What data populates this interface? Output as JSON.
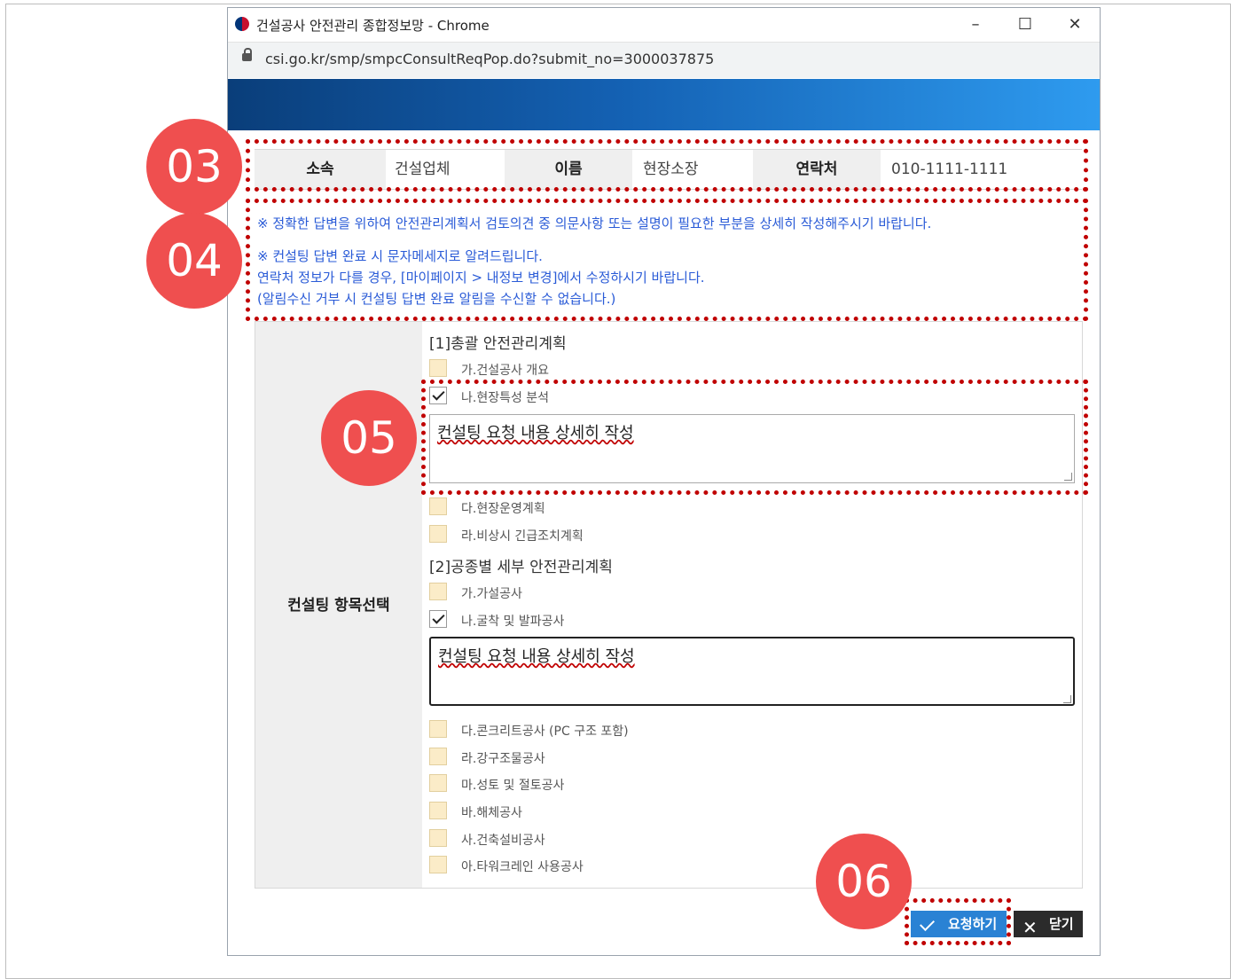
{
  "window": {
    "title": "건설공사 안전관리 종합정보망 - Chrome",
    "minimize": "–",
    "maximize": "☐",
    "close": "✕",
    "url": "csi.go.kr/smp/smpcConsultReqPop.do?submit_no=3000037875"
  },
  "info": {
    "affiliation_label": "소속",
    "affiliation_value": "건설업체",
    "name_label": "이름",
    "name_value": "현장소장",
    "contact_label": "연락처",
    "contact_value": "010-1111-1111"
  },
  "notices": {
    "line1": "※ 정확한 답변을 위하여 안전관리계획서 검토의견 중 의문사항 또는 설명이 필요한 부분을 상세히 작성해주시기 바랍니다.",
    "line2": "※ 컨설팅 답변 완료 시 문자메세지로 알려드립니다.",
    "line3": "연락처 정보가 다를 경우, [마이페이지 > 내정보 변경]에서 수정하시기 바랍니다.",
    "line4": "(알림수신 거부 시 컨설팅 답변 완료 알림을 수신할 수 없습니다.)"
  },
  "form": {
    "label": "컨설팅 항목선택",
    "section1": "[1]총괄 안전관리계획",
    "section2": "[2]공종별 세부 안전관리계획",
    "items1": [
      {
        "label": "가.건설공사 개요",
        "checked": false
      },
      {
        "label": "나.현장특성 분석",
        "checked": true
      },
      {
        "label": "다.현장운영계획",
        "checked": false
      },
      {
        "label": "라.비상시 긴급조치계획",
        "checked": false
      }
    ],
    "items2": [
      {
        "label": "가.가설공사",
        "checked": false
      },
      {
        "label": "나.굴착 및 발파공사",
        "checked": true
      },
      {
        "label": "다.콘크리트공사 (PC 구조 포함)",
        "checked": false
      },
      {
        "label": "라.강구조물공사",
        "checked": false
      },
      {
        "label": "마.성토 및 절토공사",
        "checked": false
      },
      {
        "label": "바.해체공사",
        "checked": false
      },
      {
        "label": "사.건축설비공사",
        "checked": false
      },
      {
        "label": "아.타워크레인 사용공사",
        "checked": false
      }
    ],
    "textarea1": "컨설팅 요청 내용 상세히 작성",
    "textarea2": "컨설팅 요청 내용 상세히 작성"
  },
  "buttons": {
    "request": "요청하기",
    "close": "닫기"
  },
  "badges": {
    "b03": "03",
    "b04": "04",
    "b05": "05",
    "b06": "06"
  },
  "colors": {
    "annotation_red": "#c00000",
    "badge_red": "#ef4f4f",
    "notice_blue": "#2a5bd7",
    "request_button": "#2a82d4",
    "close_button": "#2b2b2b"
  }
}
